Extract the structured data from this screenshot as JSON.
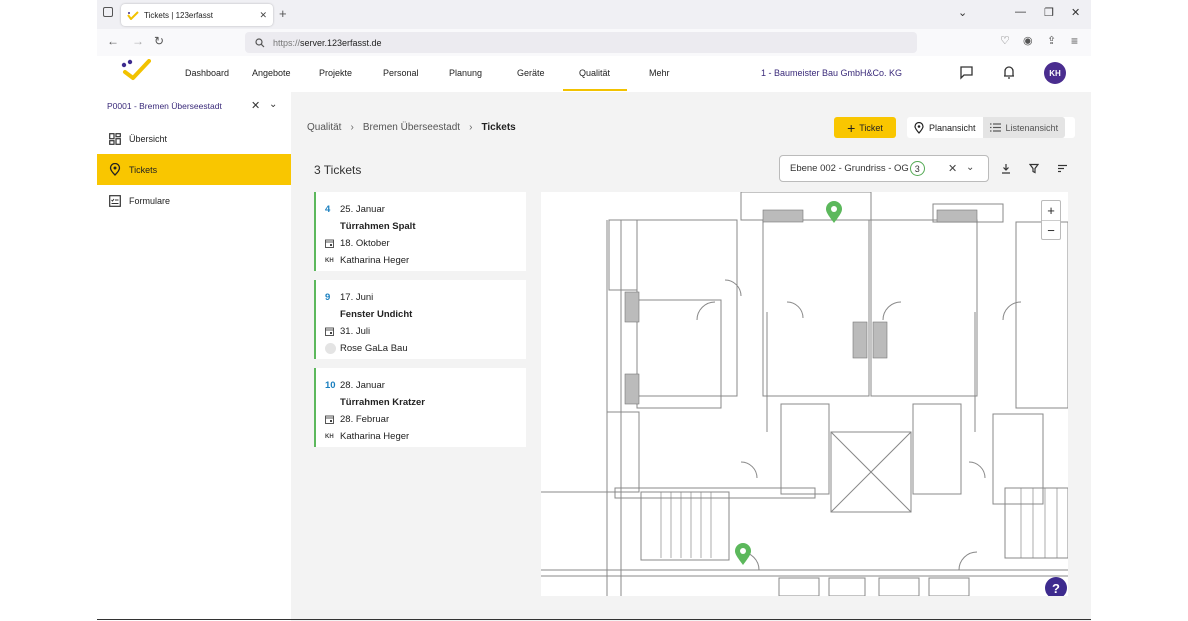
{
  "browser": {
    "tab_title": "Tickets | 123erfasst",
    "url_scheme": "https://",
    "url_host": "server.123erfasst.de"
  },
  "topnav": {
    "items": [
      "Dashboard",
      "Angebote",
      "Projekte",
      "Personal",
      "Planung",
      "Geräte",
      "Qualität",
      "Mehr"
    ],
    "active": "Qualität",
    "company": "1 - Baumeister Bau GmbH&Co. KG",
    "avatar": "KH"
  },
  "sidebar": {
    "project": "P0001 - Bremen Überseestadt",
    "items": [
      {
        "label": "Übersicht",
        "icon": "dashboard-icon",
        "active": false
      },
      {
        "label": "Tickets",
        "icon": "pin-icon",
        "active": true
      },
      {
        "label": "Formulare",
        "icon": "form-icon",
        "active": false
      }
    ]
  },
  "breadcrumb": {
    "items": [
      "Qualität",
      "Bremen Überseestadt",
      "Tickets"
    ]
  },
  "toolbar": {
    "ticket_button": "Ticket",
    "plan_view": "Planansicht",
    "list_view": "Listenansicht"
  },
  "list": {
    "count_label": "3 Tickets",
    "filter_value": "Ebene 002 - Grundriss - OG",
    "filter_badge": "3"
  },
  "tickets": [
    {
      "number": "4",
      "created": "25. Januar",
      "title": "Türrahmen Spalt",
      "due": "18. Oktober",
      "assignee_initials": "KH",
      "assignee": "Katharina Heger"
    },
    {
      "number": "9",
      "created": "17. Juni",
      "title": "Fenster Undicht",
      "due": "31. Juli",
      "assignee_initials": "",
      "assignee": "Rose GaLa Bau"
    },
    {
      "number": "10",
      "created": "28. Januar",
      "title": "Türrahmen Kratzer",
      "due": "28. Februar",
      "assignee_initials": "KH",
      "assignee": "Katharina Heger"
    }
  ],
  "map": {
    "zoom_in": "+",
    "zoom_out": "−",
    "help": "?",
    "marker_color": "#5cb85c"
  },
  "colors": {
    "accent": "#f9c600",
    "brand": "#3d2b8e",
    "ticket_border": "#5cb85c",
    "ticket_number": "#1a7fbf"
  }
}
